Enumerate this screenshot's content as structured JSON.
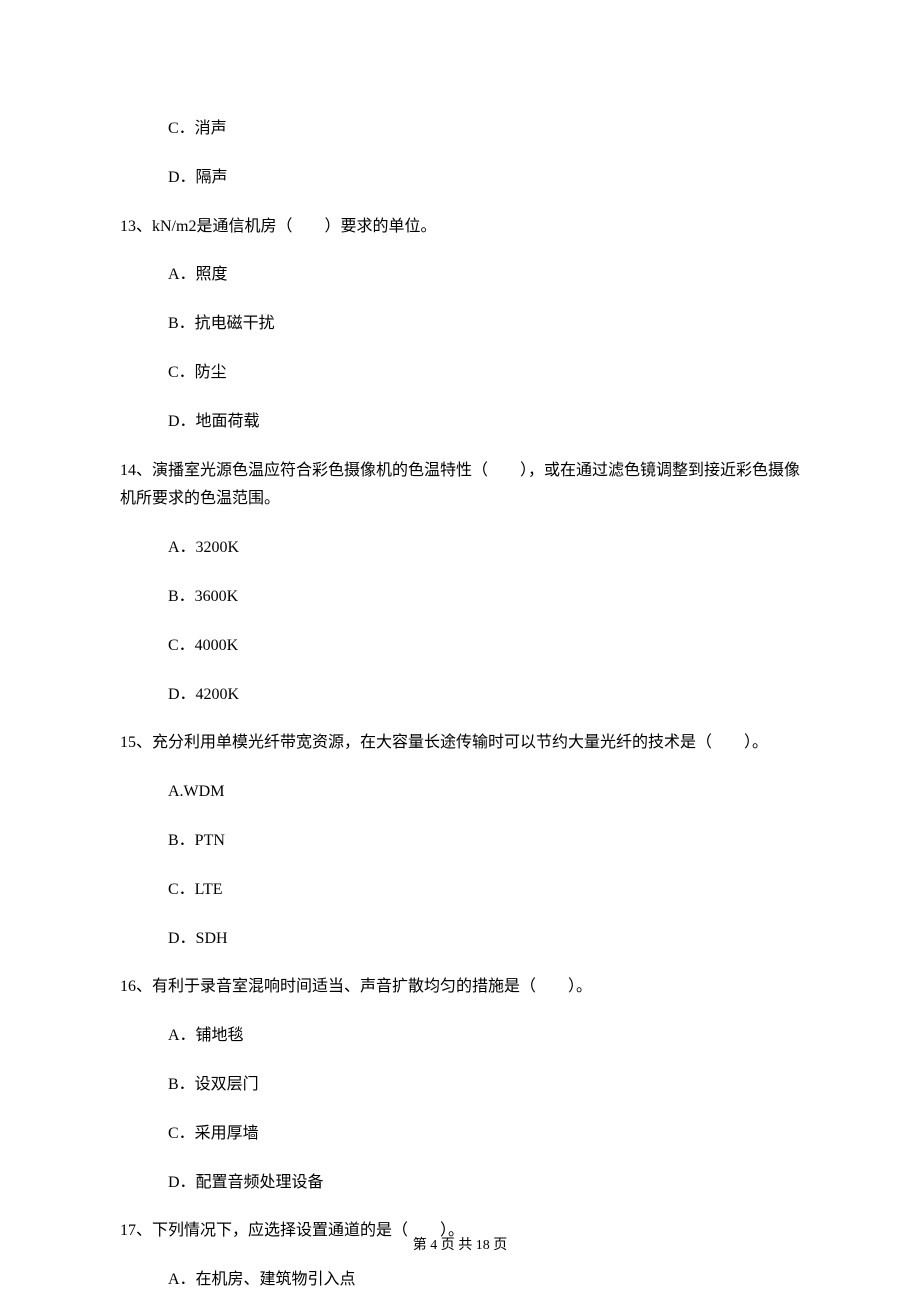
{
  "q12_orphan_options": {
    "c": "C．消声",
    "d": "D．隔声"
  },
  "q13": {
    "text": "13、kN/m2是通信机房（　　）要求的单位。",
    "options": {
      "a": "A．照度",
      "b": "B．抗电磁干扰",
      "c": "C．防尘",
      "d": "D．地面荷载"
    }
  },
  "q14": {
    "text": "14、演播室光源色温应符合彩色摄像机的色温特性（　　），或在通过滤色镜调整到接近彩色摄像机所要求的色温范围。",
    "options": {
      "a": "A．3200K",
      "b": "B．3600K",
      "c": "C．4000K",
      "d": "D．4200K"
    }
  },
  "q15": {
    "text": "15、充分利用单模光纤带宽资源，在大容量长途传输时可以节约大量光纤的技术是（　　）。",
    "options": {
      "a": "A.WDM",
      "b": "B．PTN",
      "c": "C．LTE",
      "d": "D．SDH"
    }
  },
  "q16": {
    "text": "16、有利于录音室混响时间适当、声音扩散均匀的措施是（　　）。",
    "options": {
      "a": "A．铺地毯",
      "b": "B．设双层门",
      "c": "C．采用厚墙",
      "d": "D．配置音频处理设备"
    }
  },
  "q17": {
    "text": "17、下列情况下，应选择设置通道的是（　　）。",
    "options": {
      "a": "A．在机房、建筑物引入点"
    }
  },
  "footer": "第 4 页 共 18 页"
}
